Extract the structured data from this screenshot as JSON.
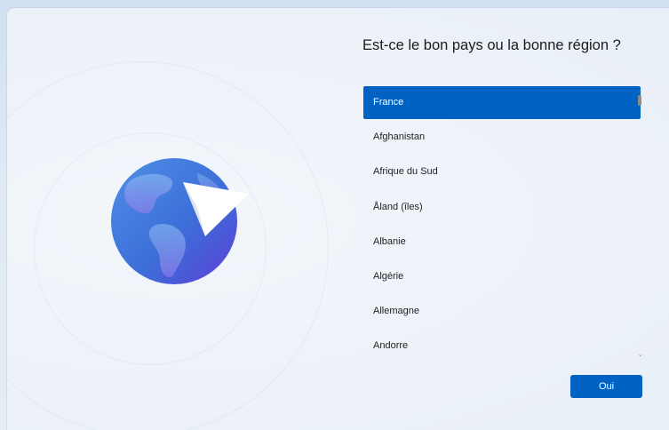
{
  "setup": {
    "question": "Est-ce le bon pays ou la bonne région ?",
    "countries": [
      {
        "label": "France",
        "selected": true
      },
      {
        "label": "Afghanistan",
        "selected": false
      },
      {
        "label": "Afrique du Sud",
        "selected": false
      },
      {
        "label": "Åland (îles)",
        "selected": false
      },
      {
        "label": "Albanie",
        "selected": false
      },
      {
        "label": "Algérie",
        "selected": false
      },
      {
        "label": "Allemagne",
        "selected": false
      },
      {
        "label": "Andorre",
        "selected": false
      }
    ],
    "confirm_label": "Oui",
    "scroll_up_glyph": "⌃",
    "scroll_down_glyph": "⌄"
  },
  "colors": {
    "accent": "#0063c3",
    "globe_light": "#4f8fe6",
    "globe_dark": "#5b3fd6"
  },
  "icons": {
    "illustration": "globe-with-paper-plane-icon"
  }
}
